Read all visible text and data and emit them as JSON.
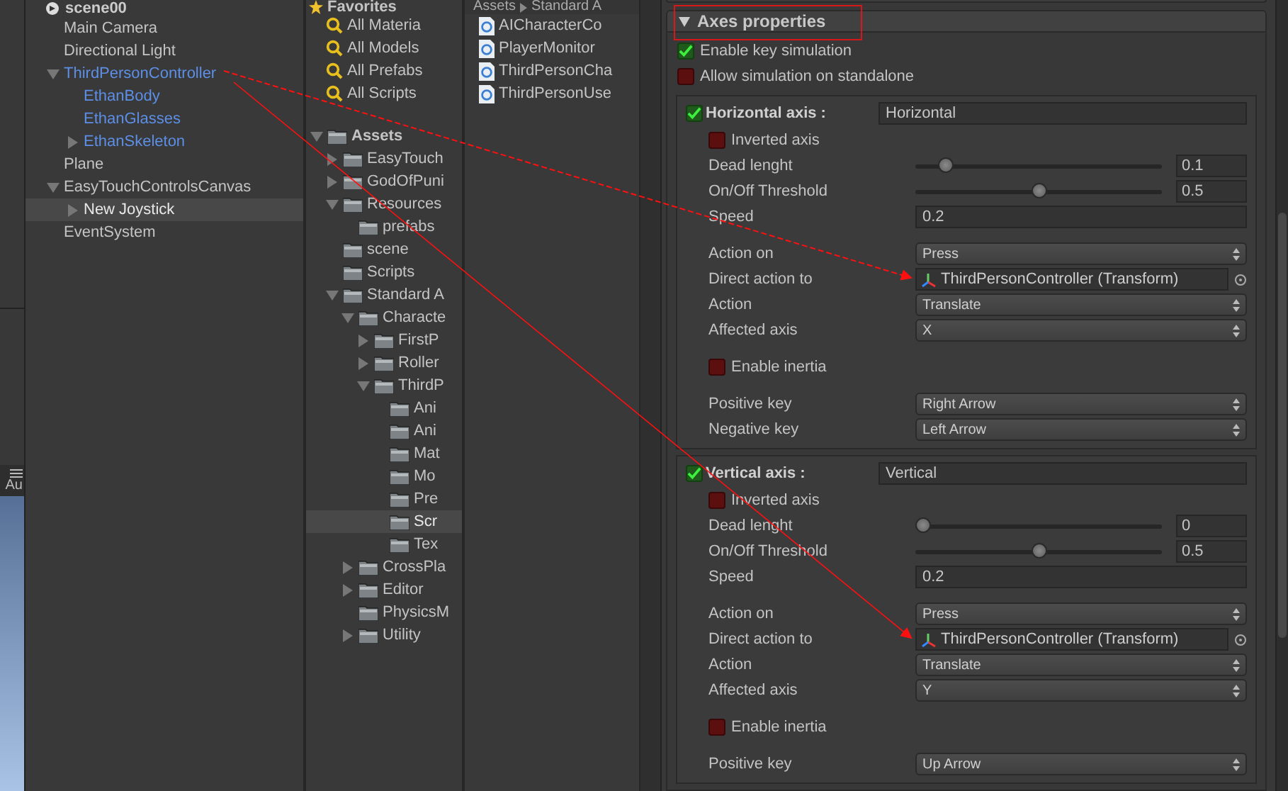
{
  "scene_view": {
    "toolbar_text": "Au"
  },
  "hierarchy": {
    "scene": "scene00",
    "items": [
      {
        "label": "Main Camera",
        "prefab": false,
        "selected": false
      },
      {
        "label": "Directional Light",
        "prefab": false,
        "selected": false
      },
      {
        "label": "ThirdPersonController",
        "prefab": true,
        "expanded": true,
        "selected": false,
        "children": [
          {
            "label": "EthanBody",
            "prefab": true,
            "selected": false
          },
          {
            "label": "EthanGlasses",
            "prefab": true,
            "selected": false
          },
          {
            "label": "EthanSkeleton",
            "prefab": true,
            "expanded": false,
            "selected": false
          }
        ]
      },
      {
        "label": "Plane",
        "prefab": false,
        "selected": false
      },
      {
        "label": "EasyTouchControlsCanvas",
        "prefab": false,
        "expanded": true,
        "selected": false,
        "children": [
          {
            "label": "New Joystick",
            "prefab": false,
            "expanded": false,
            "selected": true
          }
        ]
      },
      {
        "label": "EventSystem",
        "prefab": false,
        "selected": false
      }
    ]
  },
  "project": {
    "favorites_title": "Favorites",
    "favorites": [
      "All Materia",
      "All Models",
      "All Prefabs",
      "All Scripts"
    ],
    "tree": [
      {
        "label": "Assets",
        "expanded": true,
        "selected": false,
        "children": [
          {
            "label": "EasyTouch",
            "expanded": false,
            "selected": false
          },
          {
            "label": "GodOfPuni",
            "expanded": false,
            "selected": false
          },
          {
            "label": "Resources",
            "expanded": true,
            "selected": false,
            "children": [
              {
                "label": "prefabs",
                "selected": false
              }
            ]
          },
          {
            "label": "scene",
            "selected": false
          },
          {
            "label": "Scripts",
            "selected": false
          },
          {
            "label": "Standard A",
            "expanded": true,
            "selected": false,
            "children": [
              {
                "label": "Characte",
                "expanded": true,
                "selected": false,
                "children": [
                  {
                    "label": "FirstP",
                    "expanded": false,
                    "selected": false
                  },
                  {
                    "label": "Roller",
                    "expanded": false,
                    "selected": false
                  },
                  {
                    "label": "ThirdP",
                    "expanded": true,
                    "selected": false,
                    "children": [
                      {
                        "label": "Ani",
                        "selected": false
                      },
                      {
                        "label": "Ani",
                        "selected": false
                      },
                      {
                        "label": "Mat",
                        "selected": false
                      },
                      {
                        "label": "Mo",
                        "selected": false
                      },
                      {
                        "label": "Pre",
                        "selected": false
                      },
                      {
                        "label": "Scr",
                        "selected": true
                      },
                      {
                        "label": "Tex",
                        "selected": false
                      }
                    ]
                  }
                ]
              },
              {
                "label": "CrossPla",
                "expanded": false,
                "selected": false
              },
              {
                "label": "Editor",
                "expanded": false,
                "selected": false
              },
              {
                "label": "PhysicsM",
                "selected": false
              },
              {
                "label": "Utility",
                "expanded": false,
                "selected": false
              }
            ]
          }
        ]
      }
    ],
    "breadcrumb": [
      "Assets",
      "Standard A"
    ],
    "files": [
      "AICharacterCo",
      "PlayerMonitor",
      "ThirdPersonCha",
      "ThirdPersonUse"
    ]
  },
  "inspector": {
    "section": "Axes properties",
    "expanded": true,
    "options": [
      {
        "label": "Enable key simulation",
        "checked": true
      },
      {
        "label": "Allow simulation on standalone",
        "checked": false
      }
    ],
    "axes": [
      {
        "label": "Horizontal axis :",
        "enabled": true,
        "name": "Horizontal",
        "groups": [
          [
            {
              "kind": "checkbox",
              "label": "Inverted axis",
              "checked": false
            },
            {
              "kind": "slider",
              "label": "Dead lenght",
              "level": 0.1,
              "value": "0.1"
            },
            {
              "kind": "slider",
              "label": "On/Off Threshold",
              "level": 0.5,
              "value": "0.5"
            },
            {
              "kind": "field",
              "label": "Speed",
              "value": "0.2"
            }
          ],
          [
            {
              "kind": "dropdown",
              "label": "Action on",
              "value": "Press"
            },
            {
              "kind": "object",
              "label": "Direct action to",
              "value": "ThirdPersonController (Transform)"
            },
            {
              "kind": "dropdown",
              "label": "Action",
              "value": "Translate"
            },
            {
              "kind": "dropdown",
              "label": "Affected axis",
              "value": "X"
            }
          ],
          [
            {
              "kind": "checkbox",
              "label": "Enable inertia",
              "checked": false
            }
          ],
          [
            {
              "kind": "dropdown",
              "label": "Positive key",
              "value": "Right Arrow"
            },
            {
              "kind": "dropdown",
              "label": "Negative key",
              "value": "Left Arrow"
            }
          ]
        ]
      },
      {
        "label": "Vertical axis :",
        "enabled": true,
        "name": "Vertical",
        "groups": [
          [
            {
              "kind": "checkbox",
              "label": "Inverted axis",
              "checked": false
            },
            {
              "kind": "slider",
              "label": "Dead lenght",
              "level": 0,
              "value": "0"
            },
            {
              "kind": "slider",
              "label": "On/Off Threshold",
              "level": 0.5,
              "value": "0.5"
            },
            {
              "kind": "field",
              "label": "Speed",
              "value": "0.2"
            }
          ],
          [
            {
              "kind": "dropdown",
              "label": "Action on",
              "value": "Press"
            },
            {
              "kind": "object",
              "label": "Direct action to",
              "value": "ThirdPersonController (Transform)"
            },
            {
              "kind": "dropdown",
              "label": "Action",
              "value": "Translate"
            },
            {
              "kind": "dropdown",
              "label": "Affected axis",
              "value": "Y"
            }
          ],
          [
            {
              "kind": "checkbox",
              "label": "Enable inertia",
              "checked": false
            }
          ],
          [
            {
              "kind": "dropdown",
              "label": "Positive key",
              "value": "Up Arrow"
            }
          ]
        ]
      }
    ]
  }
}
